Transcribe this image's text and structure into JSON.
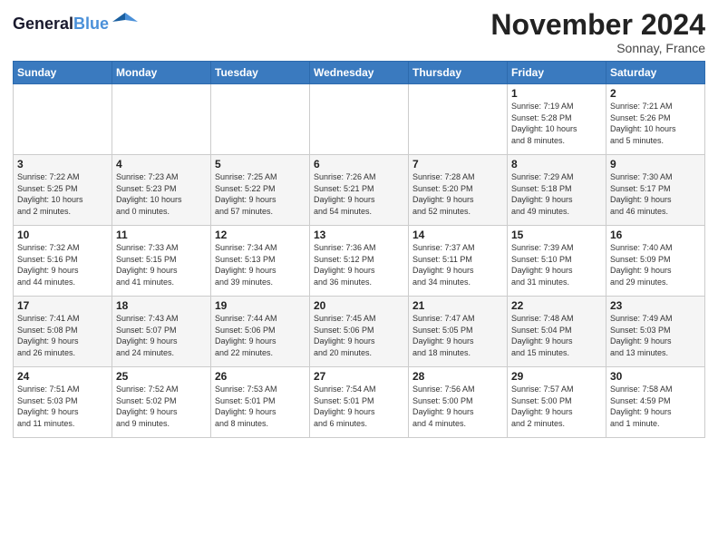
{
  "header": {
    "logo_line1": "General",
    "logo_line2": "Blue",
    "month": "November 2024",
    "location": "Sonnay, France"
  },
  "weekdays": [
    "Sunday",
    "Monday",
    "Tuesday",
    "Wednesday",
    "Thursday",
    "Friday",
    "Saturday"
  ],
  "weeks": [
    [
      {
        "day": "",
        "info": ""
      },
      {
        "day": "",
        "info": ""
      },
      {
        "day": "",
        "info": ""
      },
      {
        "day": "",
        "info": ""
      },
      {
        "day": "",
        "info": ""
      },
      {
        "day": "1",
        "info": "Sunrise: 7:19 AM\nSunset: 5:28 PM\nDaylight: 10 hours\nand 8 minutes."
      },
      {
        "day": "2",
        "info": "Sunrise: 7:21 AM\nSunset: 5:26 PM\nDaylight: 10 hours\nand 5 minutes."
      }
    ],
    [
      {
        "day": "3",
        "info": "Sunrise: 7:22 AM\nSunset: 5:25 PM\nDaylight: 10 hours\nand 2 minutes."
      },
      {
        "day": "4",
        "info": "Sunrise: 7:23 AM\nSunset: 5:23 PM\nDaylight: 10 hours\nand 0 minutes."
      },
      {
        "day": "5",
        "info": "Sunrise: 7:25 AM\nSunset: 5:22 PM\nDaylight: 9 hours\nand 57 minutes."
      },
      {
        "day": "6",
        "info": "Sunrise: 7:26 AM\nSunset: 5:21 PM\nDaylight: 9 hours\nand 54 minutes."
      },
      {
        "day": "7",
        "info": "Sunrise: 7:28 AM\nSunset: 5:20 PM\nDaylight: 9 hours\nand 52 minutes."
      },
      {
        "day": "8",
        "info": "Sunrise: 7:29 AM\nSunset: 5:18 PM\nDaylight: 9 hours\nand 49 minutes."
      },
      {
        "day": "9",
        "info": "Sunrise: 7:30 AM\nSunset: 5:17 PM\nDaylight: 9 hours\nand 46 minutes."
      }
    ],
    [
      {
        "day": "10",
        "info": "Sunrise: 7:32 AM\nSunset: 5:16 PM\nDaylight: 9 hours\nand 44 minutes."
      },
      {
        "day": "11",
        "info": "Sunrise: 7:33 AM\nSunset: 5:15 PM\nDaylight: 9 hours\nand 41 minutes."
      },
      {
        "day": "12",
        "info": "Sunrise: 7:34 AM\nSunset: 5:13 PM\nDaylight: 9 hours\nand 39 minutes."
      },
      {
        "day": "13",
        "info": "Sunrise: 7:36 AM\nSunset: 5:12 PM\nDaylight: 9 hours\nand 36 minutes."
      },
      {
        "day": "14",
        "info": "Sunrise: 7:37 AM\nSunset: 5:11 PM\nDaylight: 9 hours\nand 34 minutes."
      },
      {
        "day": "15",
        "info": "Sunrise: 7:39 AM\nSunset: 5:10 PM\nDaylight: 9 hours\nand 31 minutes."
      },
      {
        "day": "16",
        "info": "Sunrise: 7:40 AM\nSunset: 5:09 PM\nDaylight: 9 hours\nand 29 minutes."
      }
    ],
    [
      {
        "day": "17",
        "info": "Sunrise: 7:41 AM\nSunset: 5:08 PM\nDaylight: 9 hours\nand 26 minutes."
      },
      {
        "day": "18",
        "info": "Sunrise: 7:43 AM\nSunset: 5:07 PM\nDaylight: 9 hours\nand 24 minutes."
      },
      {
        "day": "19",
        "info": "Sunrise: 7:44 AM\nSunset: 5:06 PM\nDaylight: 9 hours\nand 22 minutes."
      },
      {
        "day": "20",
        "info": "Sunrise: 7:45 AM\nSunset: 5:06 PM\nDaylight: 9 hours\nand 20 minutes."
      },
      {
        "day": "21",
        "info": "Sunrise: 7:47 AM\nSunset: 5:05 PM\nDaylight: 9 hours\nand 18 minutes."
      },
      {
        "day": "22",
        "info": "Sunrise: 7:48 AM\nSunset: 5:04 PM\nDaylight: 9 hours\nand 15 minutes."
      },
      {
        "day": "23",
        "info": "Sunrise: 7:49 AM\nSunset: 5:03 PM\nDaylight: 9 hours\nand 13 minutes."
      }
    ],
    [
      {
        "day": "24",
        "info": "Sunrise: 7:51 AM\nSunset: 5:03 PM\nDaylight: 9 hours\nand 11 minutes."
      },
      {
        "day": "25",
        "info": "Sunrise: 7:52 AM\nSunset: 5:02 PM\nDaylight: 9 hours\nand 9 minutes."
      },
      {
        "day": "26",
        "info": "Sunrise: 7:53 AM\nSunset: 5:01 PM\nDaylight: 9 hours\nand 8 minutes."
      },
      {
        "day": "27",
        "info": "Sunrise: 7:54 AM\nSunset: 5:01 PM\nDaylight: 9 hours\nand 6 minutes."
      },
      {
        "day": "28",
        "info": "Sunrise: 7:56 AM\nSunset: 5:00 PM\nDaylight: 9 hours\nand 4 minutes."
      },
      {
        "day": "29",
        "info": "Sunrise: 7:57 AM\nSunset: 5:00 PM\nDaylight: 9 hours\nand 2 minutes."
      },
      {
        "day": "30",
        "info": "Sunrise: 7:58 AM\nSunset: 4:59 PM\nDaylight: 9 hours\nand 1 minute."
      }
    ]
  ]
}
